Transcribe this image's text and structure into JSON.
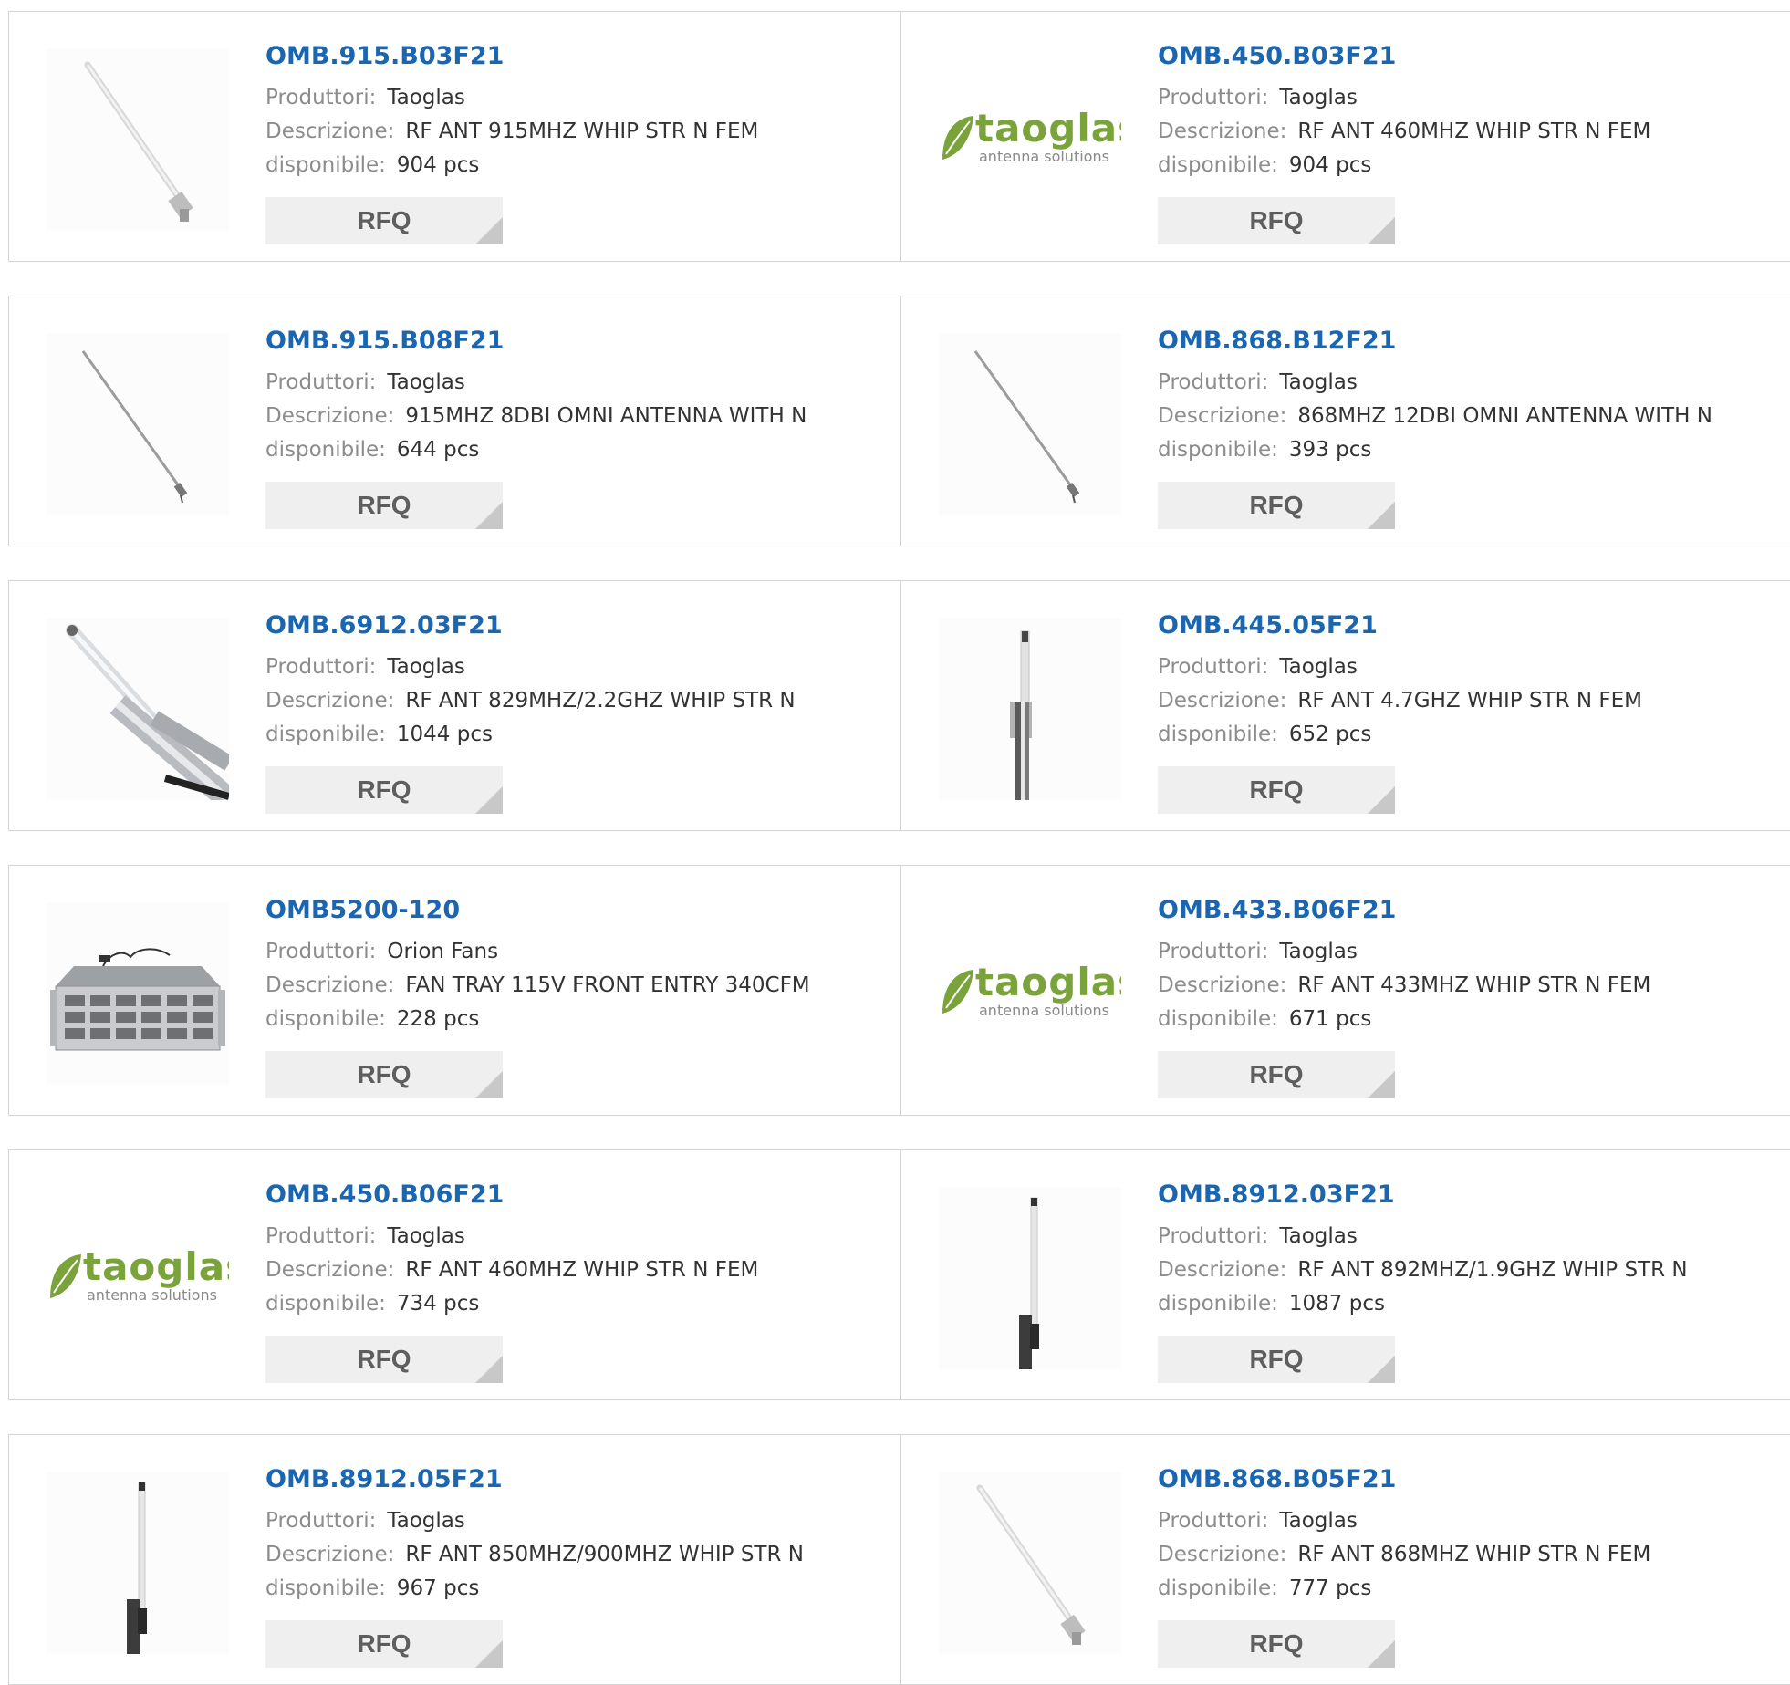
{
  "labels": {
    "manufacturer": "Produttori:",
    "description": "Descrizione:",
    "available": "disponibile:",
    "rfq": "RFQ",
    "logo_brand": "taoglas",
    "logo_tagline": "antenna solutions"
  },
  "colors": {
    "title": "#1a66b0",
    "label": "#8c8c8c",
    "value": "#333333",
    "button_bg": "#efefef",
    "button_text": "#5e5e5e",
    "logo_green": "#7ba33c"
  },
  "products": [
    {
      "part": "OMB.915.B03F21",
      "manufacturer": "Taoglas",
      "description": "RF ANT 915MHZ WHIP STR N FEM",
      "available": "904 pcs",
      "image": "antenna-whip-icon"
    },
    {
      "part": "OMB.450.B03F21",
      "manufacturer": "Taoglas",
      "description": "RF ANT 460MHZ WHIP STR N FEM",
      "available": "904 pcs",
      "image": "taoglas-logo"
    },
    {
      "part": "OMB.915.B08F21",
      "manufacturer": "Taoglas",
      "description": "915MHZ 8DBI OMNI ANTENNA WITH N",
      "available": "644 pcs",
      "image": "antenna-thin-icon"
    },
    {
      "part": "OMB.868.B12F21",
      "manufacturer": "Taoglas",
      "description": "868MHZ 12DBI OMNI ANTENNA WITH N",
      "available": "393 pcs",
      "image": "antenna-thin-icon"
    },
    {
      "part": "OMB.6912.03F21",
      "manufacturer": "Taoglas",
      "description": "RF ANT 829MHZ/2.2GHZ WHIP STR N",
      "available": "1044 pcs",
      "image": "antenna-mount-icon"
    },
    {
      "part": "OMB.445.05F21",
      "manufacturer": "Taoglas",
      "description": "RF ANT 4.7GHZ WHIP STR N FEM",
      "available": "652 pcs",
      "image": "antenna-pole-icon"
    },
    {
      "part": "OMB5200-120",
      "manufacturer": "Orion Fans",
      "description": "FAN TRAY 115V FRONT ENTRY 340CFM",
      "available": "228 pcs",
      "image": "fan-tray-icon"
    },
    {
      "part": "OMB.433.B06F21",
      "manufacturer": "Taoglas",
      "description": "RF ANT 433MHZ WHIP STR N FEM",
      "available": "671 pcs",
      "image": "taoglas-logo"
    },
    {
      "part": "OMB.450.B06F21",
      "manufacturer": "Taoglas",
      "description": "RF ANT 460MHZ WHIP STR N FEM",
      "available": "734 pcs",
      "image": "taoglas-logo"
    },
    {
      "part": "OMB.8912.03F21",
      "manufacturer": "Taoglas",
      "description": "RF ANT 892MHZ/1.9GHZ WHIP STR N",
      "available": "1087 pcs",
      "image": "antenna-vertical-icon"
    },
    {
      "part": "OMB.8912.05F21",
      "manufacturer": "Taoglas",
      "description": "RF ANT 850MHZ/900MHZ WHIP STR N",
      "available": "967 pcs",
      "image": "antenna-vertical-icon"
    },
    {
      "part": "OMB.868.B05F21",
      "manufacturer": "Taoglas",
      "description": "RF ANT 868MHZ WHIP STR N FEM",
      "available": "777 pcs",
      "image": "antenna-whip-icon"
    }
  ]
}
